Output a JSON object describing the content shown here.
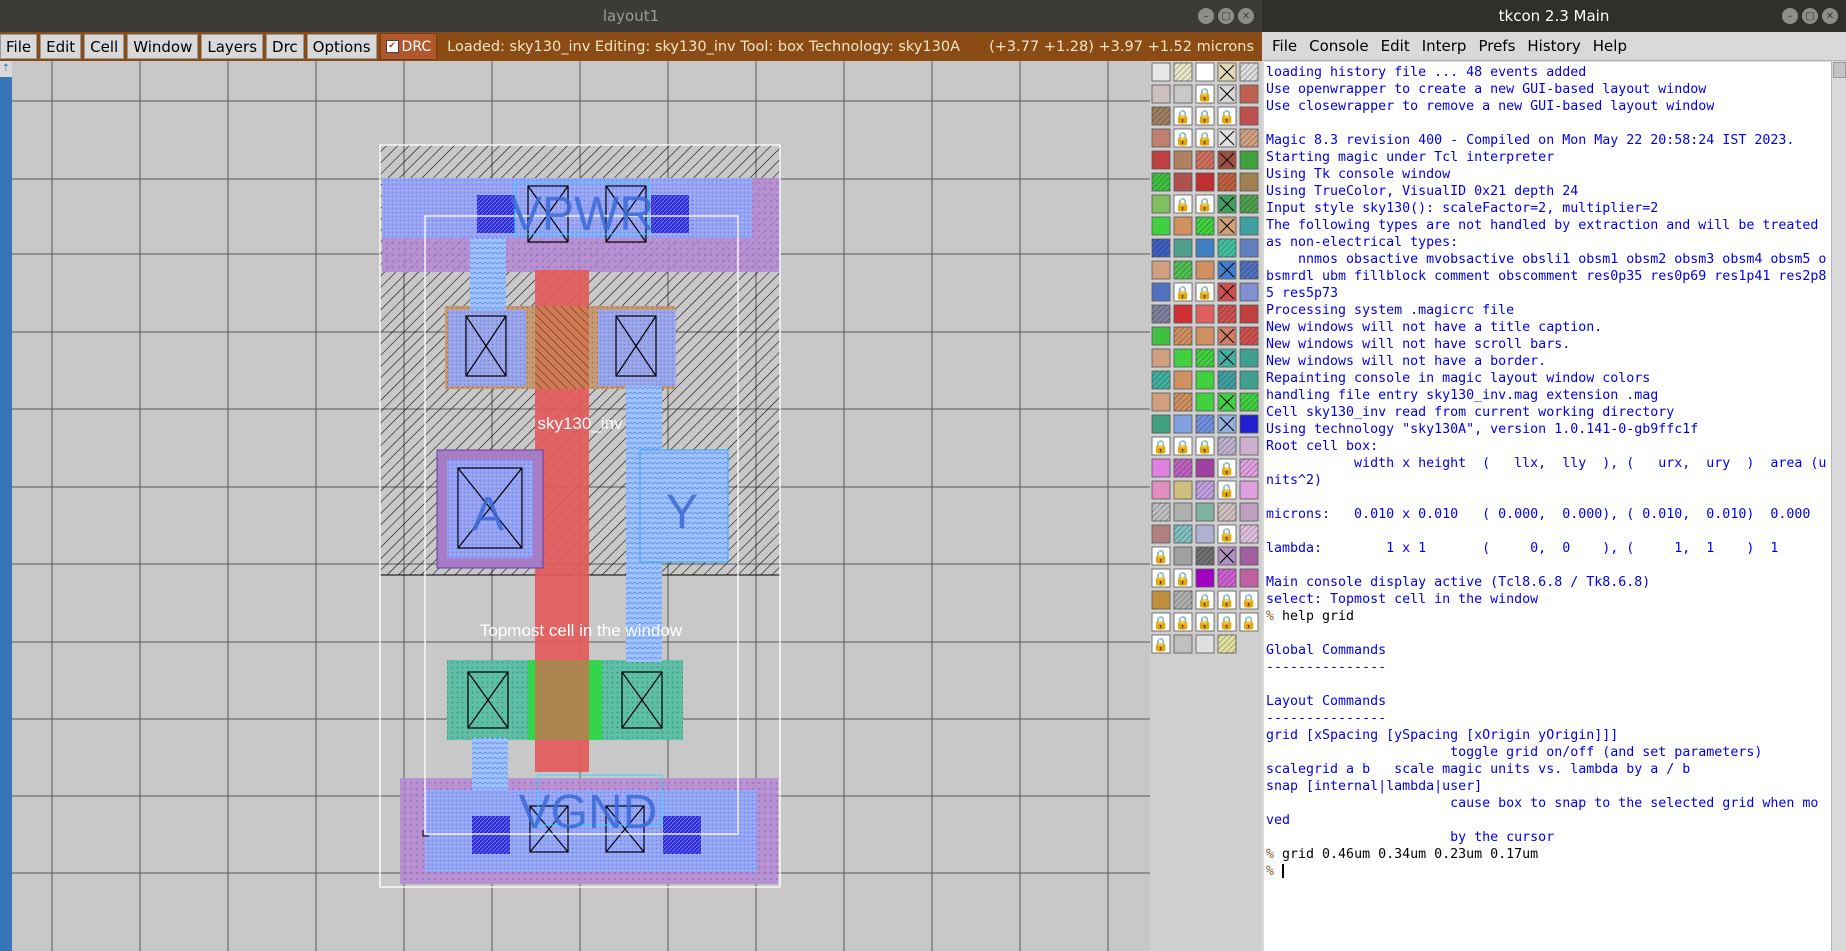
{
  "magic": {
    "title": "layout1",
    "menu": [
      "File",
      "Edit",
      "Cell",
      "Window",
      "Layers",
      "Drc",
      "Options"
    ],
    "drc_label": "DRC",
    "status": "Loaded: sky130_inv Editing: sky130_inv Tool: box  Technology: sky130A",
    "coords": "(+3.77 +1.28) +3.97 +1.52 microns",
    "layout": {
      "labels": {
        "vpwr": "VPWR",
        "vgnd": "VGND",
        "a": "A",
        "y": "Y",
        "cell": "sky130_inv",
        "topmost": "Topmost cell in the window"
      }
    }
  },
  "tkcon": {
    "title": "tkcon 2.3 Main",
    "menu": [
      "File",
      "Console",
      "Edit",
      "Interp",
      "Prefs",
      "History",
      "Help"
    ],
    "lines": [
      {
        "t": "loading history file ... 48 events added",
        "k": "out"
      },
      {
        "t": "Use openwrapper to create a new GUI-based layout window",
        "k": "out"
      },
      {
        "t": "Use closewrapper to remove a new GUI-based layout window",
        "k": "out"
      },
      {
        "t": "",
        "k": "out"
      },
      {
        "t": "Magic 8.3 revision 400 - Compiled on Mon May 22 20:58:24 IST 2023.",
        "k": "out"
      },
      {
        "t": "Starting magic under Tcl interpreter",
        "k": "out"
      },
      {
        "t": "Using Tk console window",
        "k": "out"
      },
      {
        "t": "Using TrueColor, VisualID 0x21 depth 24",
        "k": "out"
      },
      {
        "t": "Input style sky130(): scaleFactor=2, multiplier=2",
        "k": "out"
      },
      {
        "t": "The following types are not handled by extraction and will be treated",
        "k": "out"
      },
      {
        "t": "as non-electrical types:",
        "k": "out"
      },
      {
        "t": "    nnmos obsactive mvobsactive obsli1 obsm1 obsm2 obsm3 obsm4 obsm5 o",
        "k": "out"
      },
      {
        "t": "bsmrdl ubm fillblock comment obscomment res0p35 res0p69 res1p41 res2p8",
        "k": "out"
      },
      {
        "t": "5 res5p73",
        "k": "out"
      },
      {
        "t": "Processing system .magicrc file",
        "k": "out"
      },
      {
        "t": "New windows will not have a title caption.",
        "k": "out"
      },
      {
        "t": "New windows will not have scroll bars.",
        "k": "out"
      },
      {
        "t": "New windows will not have a border.",
        "k": "out"
      },
      {
        "t": "Repainting console in magic layout window colors",
        "k": "out"
      },
      {
        "t": "handling file entry sky130_inv.mag extension .mag",
        "k": "out"
      },
      {
        "t": "Cell sky130_inv read from current working directory",
        "k": "out"
      },
      {
        "t": "Using technology \"sky130A\", version 1.0.141-0-gb9ffc1f",
        "k": "out"
      },
      {
        "t": "Root cell box:",
        "k": "out"
      },
      {
        "t": "           width x height  (   llx,  lly  ), (   urx,  ury  )  area (u",
        "k": "out"
      },
      {
        "t": "nits^2)",
        "k": "out"
      },
      {
        "t": "",
        "k": "out"
      },
      {
        "t": "microns:   0.010 x 0.010   ( 0.000,  0.000), ( 0.010,  0.010)  0.000",
        "k": "out"
      },
      {
        "t": "",
        "k": "out"
      },
      {
        "t": "lambda:        1 x 1       (     0,  0    ), (     1,  1    )  1",
        "k": "out"
      },
      {
        "t": "",
        "k": "out"
      },
      {
        "t": "Main console display active (Tcl8.6.8 / Tk8.6.8)",
        "k": "out"
      },
      {
        "t": "select: Topmost cell in the window",
        "k": "out"
      },
      {
        "t": "help grid",
        "k": "cmd"
      },
      {
        "t": "",
        "k": "out"
      },
      {
        "t": "Global Commands",
        "k": "out"
      },
      {
        "t": "---------------",
        "k": "out"
      },
      {
        "t": "",
        "k": "out"
      },
      {
        "t": "Layout Commands",
        "k": "out"
      },
      {
        "t": "---------------",
        "k": "out"
      },
      {
        "t": "grid [xSpacing [ySpacing [xOrigin yOrigin]]]",
        "k": "out"
      },
      {
        "t": "                       toggle grid on/off (and set parameters)",
        "k": "out"
      },
      {
        "t": "scalegrid a b   scale magic units vs. lambda by a / b",
        "k": "out"
      },
      {
        "t": "snap [internal|lambda|user]",
        "k": "out"
      },
      {
        "t": "                       cause box to snap to the selected grid when mo",
        "k": "out"
      },
      {
        "t": "ved",
        "k": "out"
      },
      {
        "t": "                       by the cursor",
        "k": "out"
      },
      {
        "t": "grid 0.46um 0.34um 0.23um 0.17um",
        "k": "cmd"
      },
      {
        "t": "",
        "k": "prompt"
      }
    ]
  }
}
